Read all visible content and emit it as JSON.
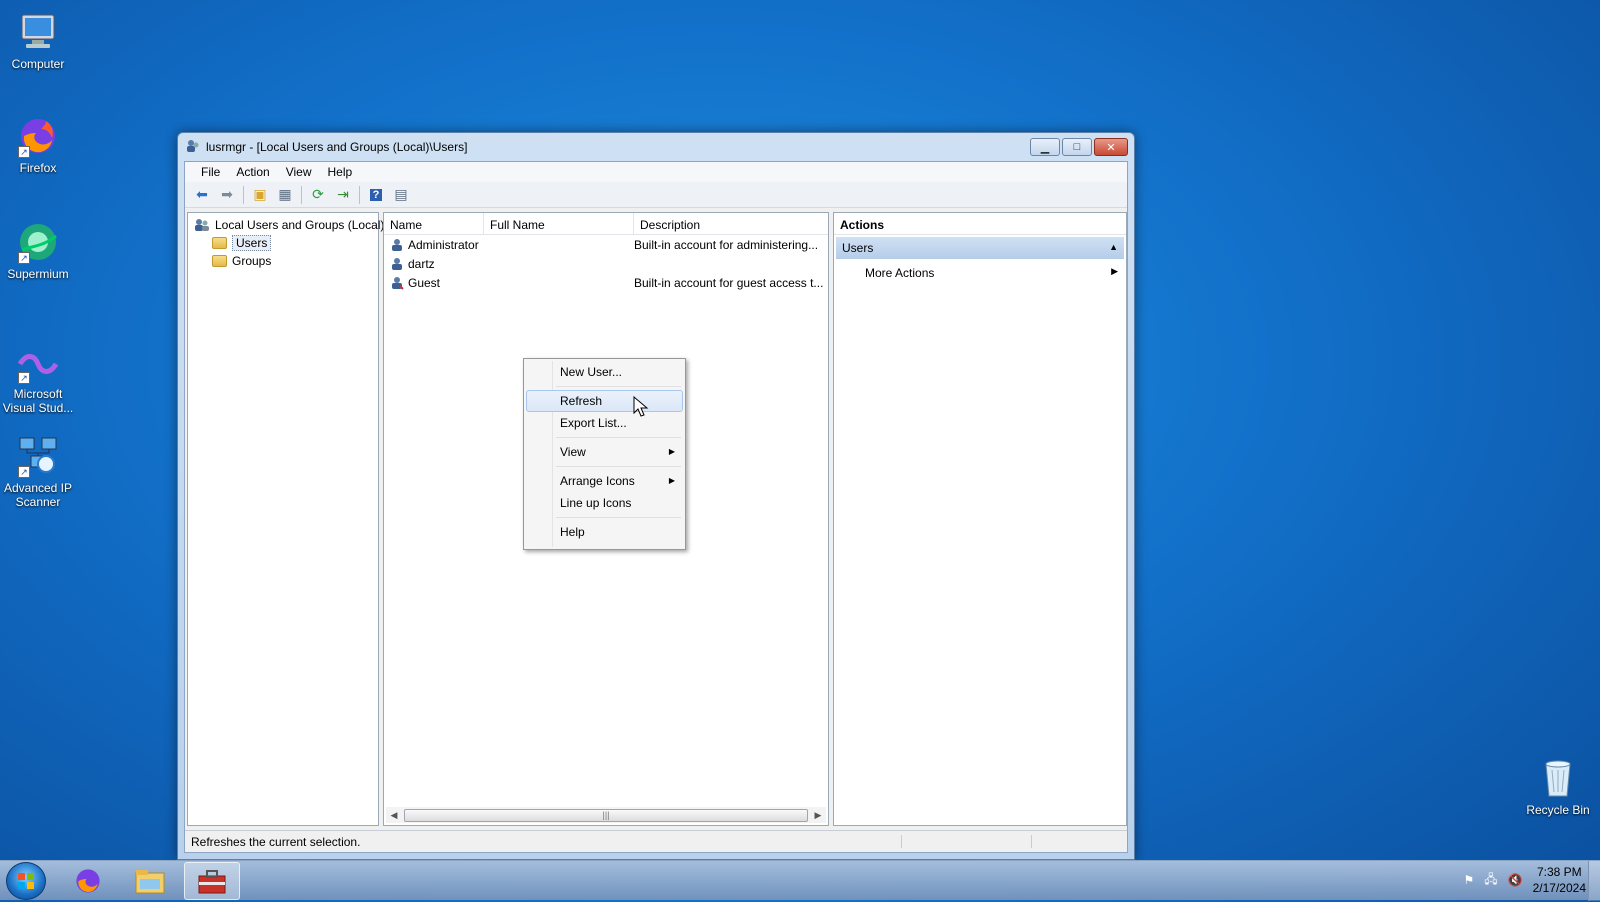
{
  "desktop": {
    "icons": [
      {
        "label": "Computer"
      },
      {
        "label": "Firefox"
      },
      {
        "label": "Supermium"
      },
      {
        "label": "Microsoft Visual Stud..."
      },
      {
        "label": "Advanced IP Scanner"
      },
      {
        "label": "Recycle Bin"
      }
    ]
  },
  "window": {
    "title": "lusrmgr - [Local Users and Groups (Local)\\Users]",
    "menu": [
      "File",
      "Action",
      "View",
      "Help"
    ],
    "tree": {
      "root": "Local Users and Groups (Local)",
      "items": [
        "Users",
        "Groups"
      ]
    },
    "list": {
      "columns": [
        "Name",
        "Full Name",
        "Description"
      ],
      "rows": [
        {
          "name": "Administrator",
          "full_name": "",
          "description": "Built-in account for administering..."
        },
        {
          "name": "dartz",
          "full_name": "",
          "description": ""
        },
        {
          "name": "Guest",
          "full_name": "",
          "description": "Built-in account for guest access t..."
        }
      ]
    },
    "actions": {
      "header": "Actions",
      "section": "Users",
      "more": "More Actions"
    },
    "status": "Refreshes the current selection."
  },
  "context_menu": {
    "items": [
      "New User...",
      "Refresh",
      "Export List...",
      "View",
      "Arrange Icons",
      "Line up Icons",
      "Help"
    ]
  },
  "taskbar": {
    "time": "7:38 PM",
    "date": "2/17/2024"
  },
  "colors": {
    "desktop": "#1270c9",
    "highlight": "#dbe7f7",
    "actions_section": "#cfe0f3"
  }
}
